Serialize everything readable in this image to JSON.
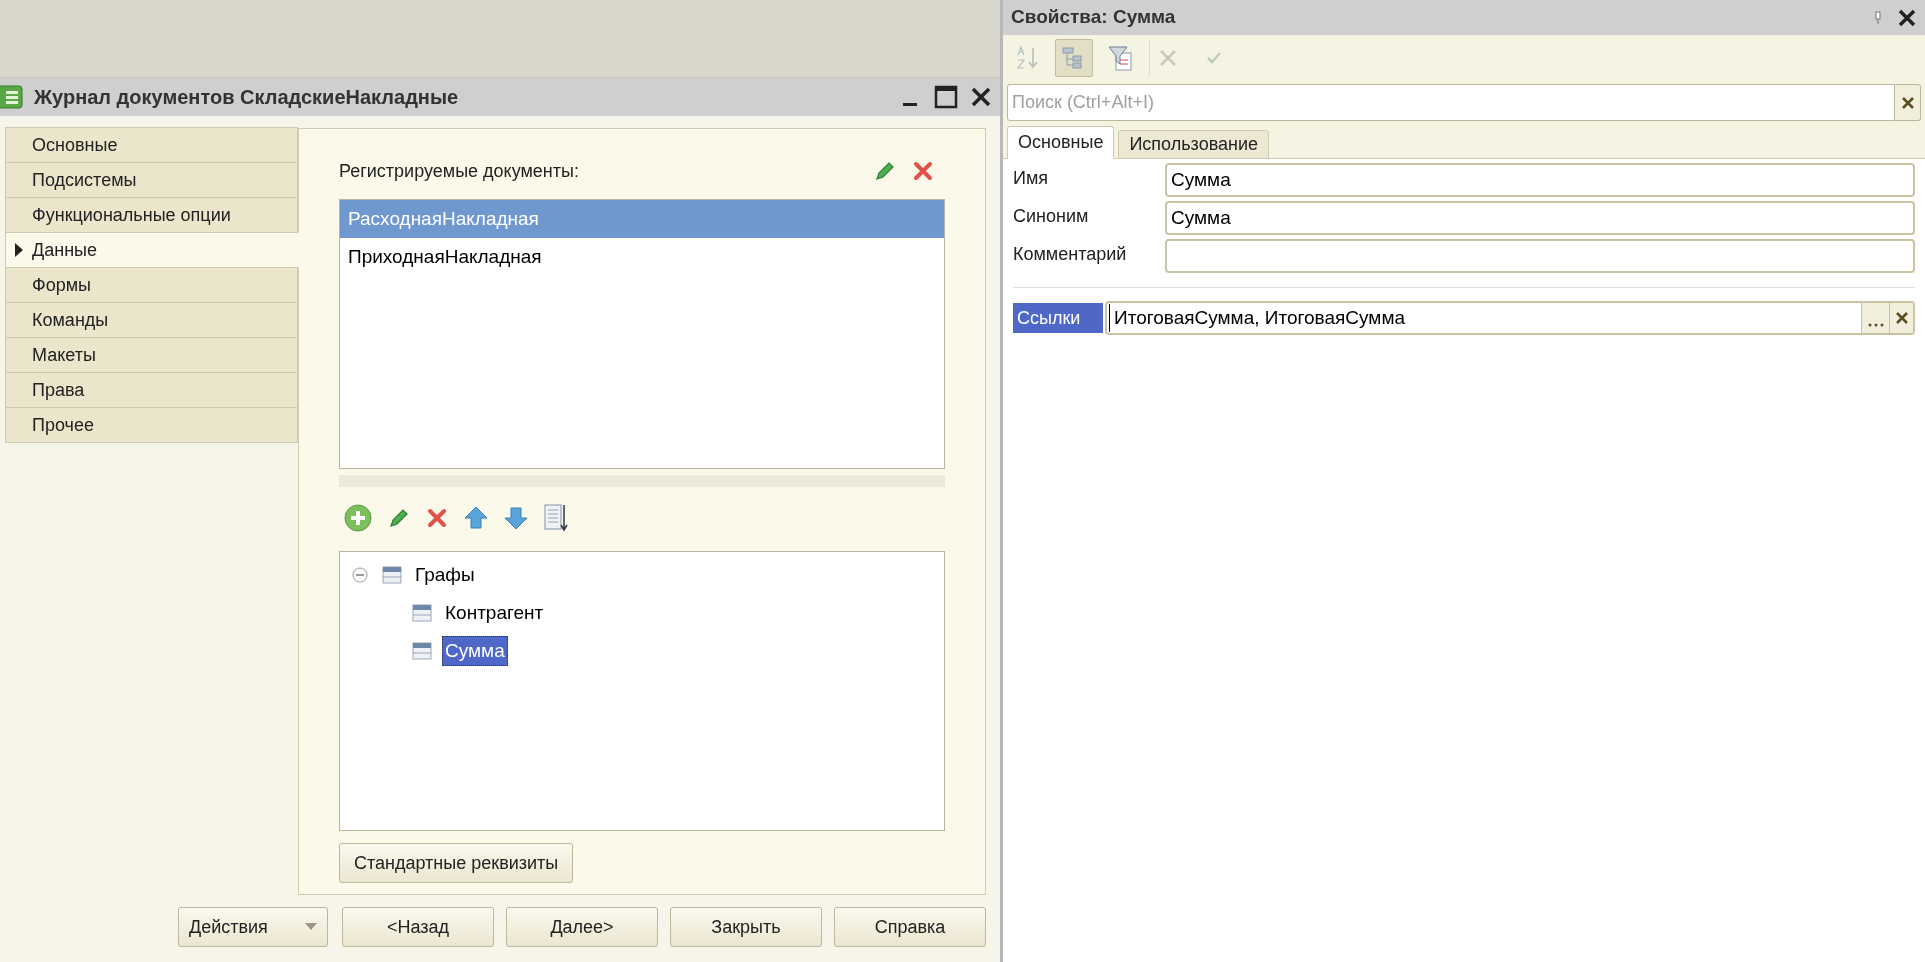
{
  "left_window": {
    "title": "Журнал документов СкладскиеНакладные",
    "sections": [
      {
        "label": "Основные",
        "selected": false
      },
      {
        "label": "Подсистемы",
        "selected": false
      },
      {
        "label": "Функциональные опции",
        "selected": false
      },
      {
        "label": "Данные",
        "selected": true
      },
      {
        "label": "Формы",
        "selected": false
      },
      {
        "label": "Команды",
        "selected": false
      },
      {
        "label": "Макеты",
        "selected": false
      },
      {
        "label": "Права",
        "selected": false
      },
      {
        "label": "Прочее",
        "selected": false
      }
    ],
    "registered_documents": {
      "label": "Регистрируемые документы:",
      "items": [
        {
          "label": "РасходнаяНакладная",
          "selected": true
        },
        {
          "label": "ПриходнаяНакладная",
          "selected": false
        }
      ]
    },
    "columns_tree": {
      "items": [
        {
          "label": "Графы",
          "expanded": true,
          "selected": false,
          "children": [
            {
              "label": "Контрагент",
              "selected": false
            },
            {
              "label": "Сумма",
              "selected": true
            }
          ]
        }
      ]
    },
    "standard_attributes_button": "Стандартные реквизиты",
    "footer_buttons": [
      {
        "label": "Действия",
        "kind": "dropdown"
      },
      {
        "label": "<Назад",
        "kind": "plain"
      },
      {
        "label": "Далее>",
        "kind": "plain"
      },
      {
        "label": "Закрыть",
        "kind": "plain"
      },
      {
        "label": "Справка",
        "kind": "plain"
      }
    ]
  },
  "properties_panel": {
    "title": "Свойства: Сумма",
    "toolbar": [
      {
        "kind": "sort",
        "pressed": false,
        "disabled": true
      },
      {
        "kind": "tree",
        "pressed": true,
        "disabled": false
      },
      {
        "kind": "filter",
        "pressed": false,
        "disabled": false
      },
      {
        "kind": "cancel",
        "pressed": false,
        "disabled": true
      },
      {
        "kind": "apply",
        "pressed": false,
        "disabled": true
      }
    ],
    "search": {
      "placeholder": "Поиск (Ctrl+Alt+I)"
    },
    "tabs": [
      {
        "label": "Основные",
        "selected": true
      },
      {
        "label": "Использование",
        "selected": false
      }
    ],
    "fields": [
      {
        "label": "Имя",
        "value": "Сумма"
      },
      {
        "label": "Синоним",
        "value": "Сумма"
      },
      {
        "label": "Комментарий"
      }
    ],
    "links": {
      "label": "Ссылки",
      "highlighted": true,
      "value": "ИтоговаяСумма, ИтоговаяСумма"
    }
  }
}
